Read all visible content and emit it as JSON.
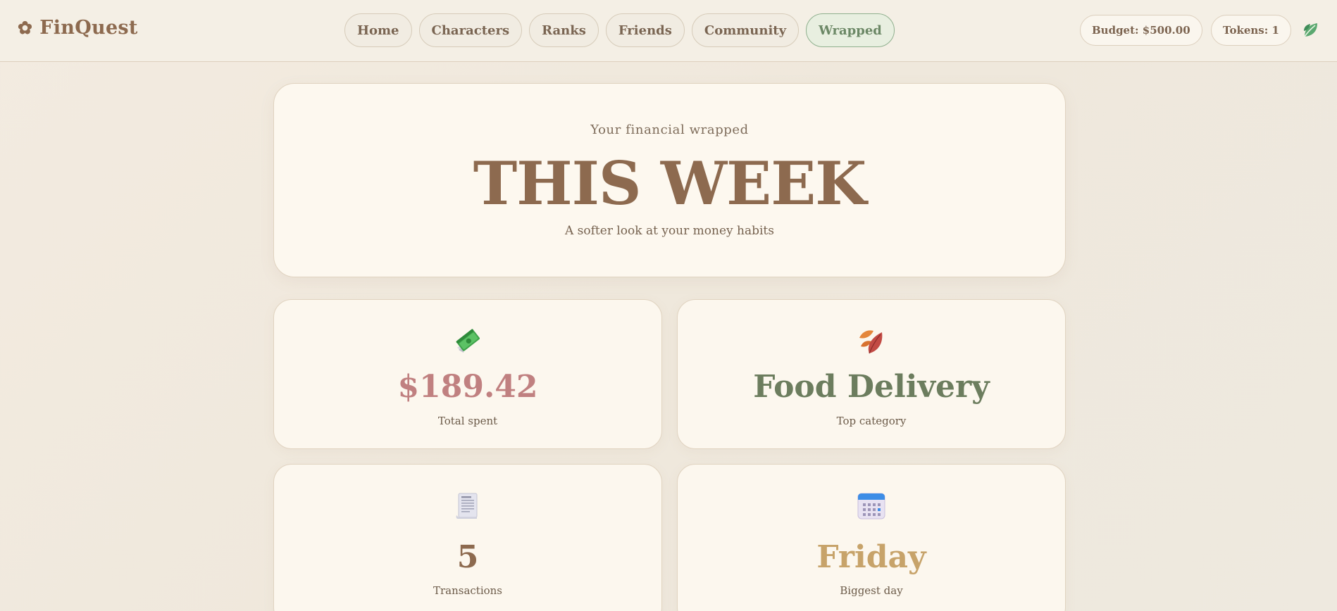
{
  "app": {
    "name": "FinQuest",
    "logo_glyph": "✿"
  },
  "nav": {
    "items": [
      {
        "label": "Home",
        "active": false
      },
      {
        "label": "Characters",
        "active": false
      },
      {
        "label": "Ranks",
        "active": false
      },
      {
        "label": "Friends",
        "active": false
      },
      {
        "label": "Community",
        "active": false
      },
      {
        "label": "Wrapped",
        "active": true
      }
    ]
  },
  "status": {
    "budget": "Budget: $500.00",
    "tokens": "Tokens: 1",
    "profile_icon": "leaf-icon"
  },
  "hero": {
    "eyebrow": "Your financial wrapped",
    "title": "THIS WEEK",
    "subtitle": "A softer look at your money habits"
  },
  "cards": [
    {
      "icon": "money-with-wings-icon",
      "value": "$189.42",
      "label": "Total spent",
      "value_color": "#c08080"
    },
    {
      "icon": "fallen-leaf-icon",
      "value": "Food Delivery",
      "label": "Top category",
      "value_color": "#6c7d5e"
    },
    {
      "icon": "receipt-icon",
      "value": "5",
      "label": "Transactions",
      "value_color": "#8d6a4f"
    },
    {
      "icon": "calendar-icon",
      "value": "Friday",
      "label": "Biggest day",
      "value_color": "#c7a36a"
    }
  ],
  "colors": {
    "brand": "#8d6a4f",
    "active_nav": "#6c8866",
    "background": "#f3ebe0"
  }
}
